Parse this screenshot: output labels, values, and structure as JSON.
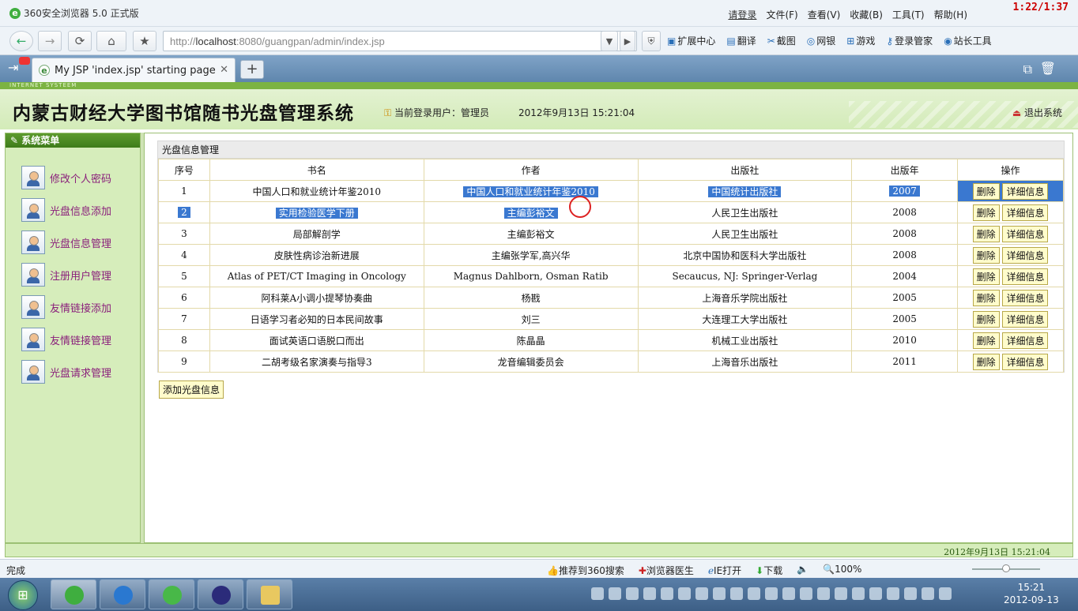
{
  "browser": {
    "title": "360安全浏览器 5.0 正式版",
    "menu": [
      "请登录",
      "文件(F)",
      "查看(V)",
      "收藏(B)",
      "工具(T)",
      "帮助(H)"
    ],
    "clock_overlay": "1:22/1:37",
    "url_prefix": "http://",
    "url_host": "localhost",
    "url_rest": ":8080/guangpan/admin/index.jsp",
    "toolbar": [
      "扩展中心",
      "翻译",
      "截图",
      "网银",
      "游戏",
      "登录管家",
      "站长工具"
    ],
    "tab_title": "My JSP 'index.jsp' starting page",
    "status": "完成",
    "status_right": [
      "推荐到360搜索",
      "浏览器医生",
      "IE打开",
      "下载",
      "100%"
    ]
  },
  "header": {
    "stripe": "INTERNET SYSTEEM",
    "system_title": "内蒙古财经大学图书馆随书光盘管理系统",
    "user_label": "当前登录用户：管理员",
    "datetime": "2012年9月13日  15:21:04",
    "logout": "退出系统"
  },
  "sidebar": {
    "title": "系统菜单",
    "items": [
      {
        "label": "修改个人密码"
      },
      {
        "label": "光盘信息添加"
      },
      {
        "label": "光盘信息管理"
      },
      {
        "label": "注册用户管理"
      },
      {
        "label": "友情链接添加"
      },
      {
        "label": "友情链接管理"
      },
      {
        "label": "光盘请求管理"
      }
    ]
  },
  "main": {
    "panel_title": "光盘信息管理",
    "columns": [
      "序号",
      "书名",
      "作者",
      "出版社",
      "出版年",
      "操作"
    ],
    "rows": [
      {
        "no": "1",
        "title": "中国人口和就业统计年鉴2010",
        "author": "中国人口和就业统计年鉴2010",
        "publisher": "中国统计出版社",
        "year": "2007"
      },
      {
        "no": "2",
        "title": "实用检验医学下册",
        "author": "主编彭裕文",
        "publisher": "人民卫生出版社",
        "year": "2008"
      },
      {
        "no": "3",
        "title": "局部解剖学",
        "author": "主编彭裕文",
        "publisher": "人民卫生出版社",
        "year": "2008"
      },
      {
        "no": "4",
        "title": "皮肤性病诊治新进展",
        "author": "主编张学军,高兴华",
        "publisher": "北京中国协和医科大学出版社",
        "year": "2008"
      },
      {
        "no": "5",
        "title": "Atlas of PET/CT Imaging in Oncology",
        "author": "Magnus Dahlborn, Osman Ratib",
        "publisher": "Secaucus, NJ: Springer-Verlag",
        "year": "2004"
      },
      {
        "no": "6",
        "title": "阿科莱A小调小提琴协奏曲",
        "author": "杨戡",
        "publisher": "上海音乐学院出版社",
        "year": "2005"
      },
      {
        "no": "7",
        "title": "日语学习者必知的日本民间故事",
        "author": "刘三",
        "publisher": "大连理工大学出版社",
        "year": "2005"
      },
      {
        "no": "8",
        "title": "面试英语口语脱口而出",
        "author": "陈晶晶",
        "publisher": "机械工业出版社",
        "year": "2010"
      },
      {
        "no": "9",
        "title": "二胡考级名家演奏与指导3",
        "author": "龙音编辑委员会",
        "publisher": "上海音乐出版社",
        "year": "2011"
      }
    ],
    "delete_label": "删除",
    "detail_label": "详细信息",
    "add_button": "添加光盘信息"
  },
  "footer": {
    "datetime": "2012年9月13日  15:21:04"
  },
  "taskbar": {
    "time": "15:21",
    "date": "2012-09-13"
  }
}
